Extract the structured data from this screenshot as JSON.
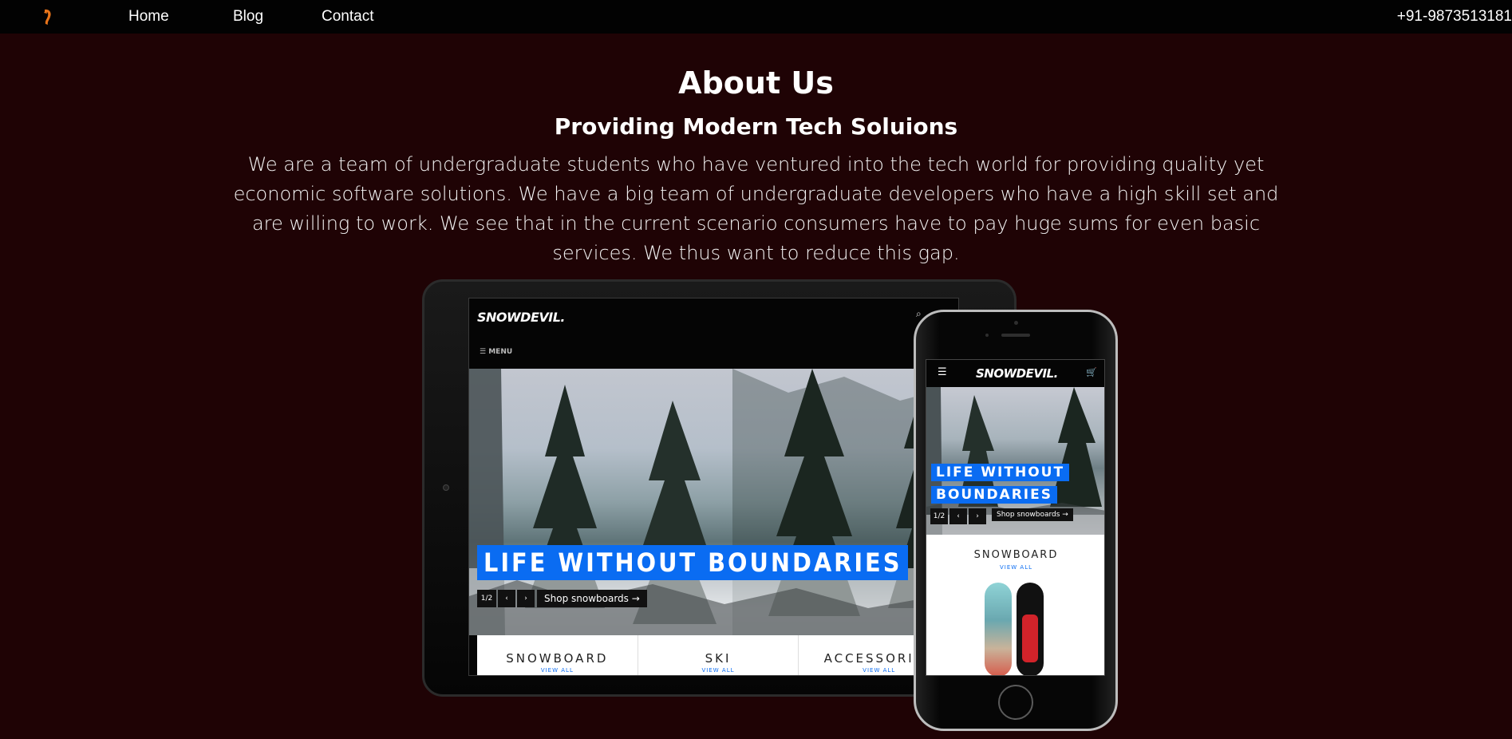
{
  "nav": {
    "home": "Home",
    "blog": "Blog",
    "contact": "Contact",
    "phone": "+91-9873513181"
  },
  "about": {
    "title": "About Us",
    "subtitle": "Providing Modern Tech Soluions",
    "text": "We are a team of undergraduate students who have ventured into the tech world for providing quality yet economic software solutions. We have a big team of undergraduate developers who have a high skill set and are willing to work. We see that in the current scenario consumers have to pay huge sums for even basic services. We thus want to reduce this gap."
  },
  "tablet": {
    "brand": "SNOWDEVIL.",
    "menu": "MENU",
    "hero": "LIFE WITHOUT BOUNDARIES",
    "pager": "1/2",
    "prev": "‹",
    "next": "›",
    "shop": "Shop snowboards →",
    "categories": [
      {
        "name": "SNOWBOARD",
        "view": "VIEW ALL"
      },
      {
        "name": "SKI",
        "view": "VIEW ALL"
      },
      {
        "name": "ACCESSORIES",
        "view": "VIEW ALL"
      }
    ]
  },
  "phone": {
    "brand": "SNOWDEVIL.",
    "hero_line1": "LIFE WITHOUT",
    "hero_line2": "BOUNDARIES",
    "pager": "1/2",
    "prev": "‹",
    "next": "›",
    "shop": "Shop snowboards →",
    "card_name": "SNOWBOARD",
    "card_view": "VIEW ALL"
  },
  "colors": {
    "background": "#1f0305",
    "nav": "#020202",
    "accent": "#0a6cf2",
    "logo": "#e8741a"
  },
  "icons": {
    "logo": "orange-logo-icon",
    "tablet_menu": "hamburger-icon",
    "tablet_search": "search-icon",
    "phone_menu": "hamburger-icon",
    "phone_cart": "cart-icon"
  }
}
